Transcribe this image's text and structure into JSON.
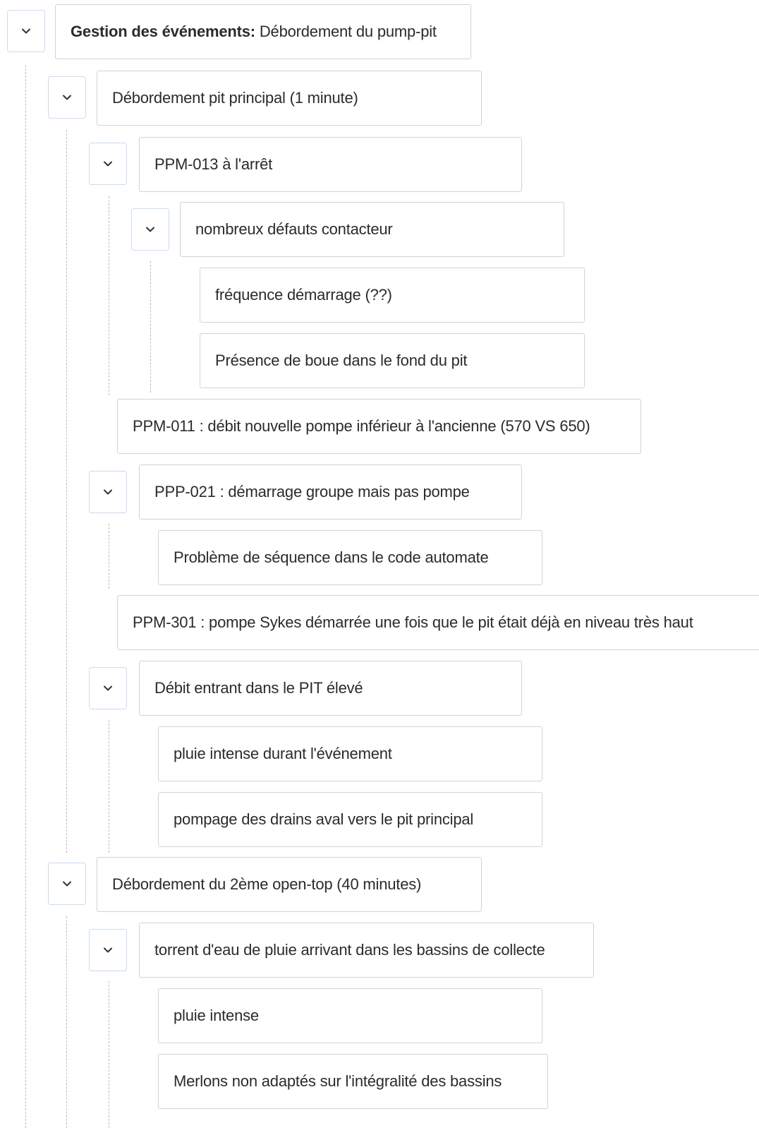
{
  "tree": {
    "root": {
      "label_bold": "Gestion des événements:",
      "label": " Débordement du pump-pit"
    },
    "n1": "Débordement pit principal (1 minute)",
    "n1_1": "PPM-013 à l'arrêt",
    "n1_1_1": "nombreux défauts contacteur",
    "n1_1_1_1": "fréquence démarrage (??)",
    "n1_1_1_2": "Présence de boue dans le fond du pit",
    "n1_2": "PPM-011 : débit nouvelle pompe inférieur à l'ancienne (570 VS 650)",
    "n1_3": "PPP-021 : démarrage groupe mais pas pompe",
    "n1_3_1": "Problème de séquence dans le code automate",
    "n1_4": "PPM-301 : pompe Sykes démarrée une fois que le pit était déjà en niveau très haut",
    "n1_5": "Débit entrant dans le PIT élevé",
    "n1_5_1": "pluie intense durant l'événement",
    "n1_5_2": "pompage des drains aval vers le pit principal",
    "n2": "Débordement du 2ème open-top (40 minutes)",
    "n2_1": "torrent d'eau de pluie arrivant dans les bassins de collecte",
    "n2_1_1": "pluie intense",
    "n2_1_2": "Merlons non adaptés sur l'intégralité des bassins"
  },
  "icons": {
    "toggle": "chevron-down-icon"
  },
  "colors": {
    "node_border": "#cfd3d8",
    "toggle_border": "#c9dcf2",
    "guide_line": "#b8bcc2",
    "text": "#2b2b2b"
  }
}
